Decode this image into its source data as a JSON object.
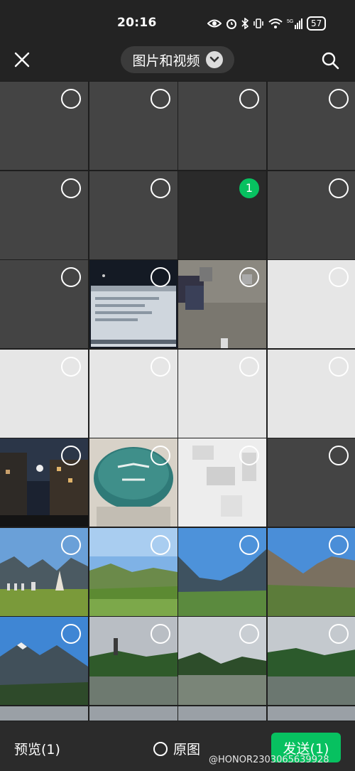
{
  "status_bar": {
    "time": "20:16",
    "battery": "57"
  },
  "header": {
    "album_label": "图片和视频",
    "close_icon": "close-icon",
    "search_icon": "search-icon"
  },
  "grid": {
    "selected_number": "1",
    "cells": [
      {
        "kind": "dark"
      },
      {
        "kind": "dark"
      },
      {
        "kind": "dark"
      },
      {
        "kind": "dark"
      },
      {
        "kind": "dark"
      },
      {
        "kind": "dark"
      },
      {
        "kind": "darker",
        "selected": true
      },
      {
        "kind": "dark"
      },
      {
        "kind": "dark"
      },
      {
        "kind": "laptop-photo"
      },
      {
        "kind": "pixelated-ground-photo"
      },
      {
        "kind": "light"
      },
      {
        "kind": "light"
      },
      {
        "kind": "light"
      },
      {
        "kind": "light"
      },
      {
        "kind": "light"
      },
      {
        "kind": "night-buildings-photo"
      },
      {
        "kind": "green-cake-photo"
      },
      {
        "kind": "pixelated-light-photo"
      },
      {
        "kind": "dark"
      },
      {
        "kind": "mountain-stupa-photo"
      },
      {
        "kind": "green-valley-photo"
      },
      {
        "kind": "valley-mountains-photo"
      },
      {
        "kind": "rocky-mountain-photo"
      },
      {
        "kind": "snow-mountain-photo"
      },
      {
        "kind": "lake-pagoda-photo"
      },
      {
        "kind": "lake-photo"
      },
      {
        "kind": "lake-forest-photo"
      }
    ]
  },
  "footer": {
    "preview_label": "预览(1)",
    "original_label": "原图",
    "send_label": "发送(1)"
  },
  "watermark": "@HONOR2303065639928",
  "colors": {
    "accent": "#07c160",
    "background": "#1e1e1e",
    "tile_dark": "#444444",
    "tile_light": "#e8e8e8"
  }
}
